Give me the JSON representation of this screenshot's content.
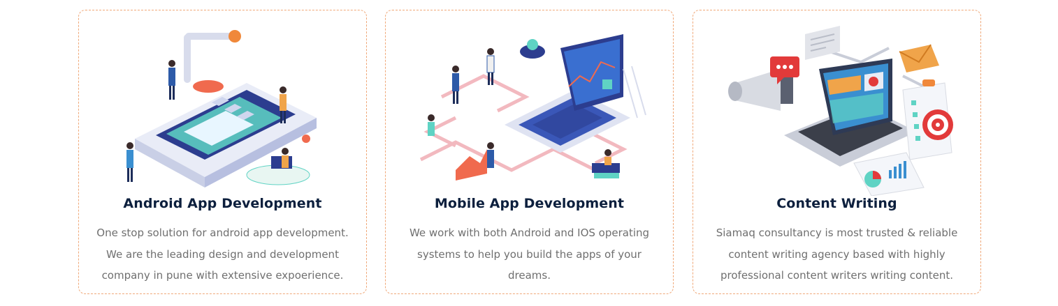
{
  "services": [
    {
      "title": "Android App Development",
      "description": "One stop solution for android app development. We are the leading design and development company in pune with extensive expoerience."
    },
    {
      "title": "Mobile App Development",
      "description": "We work with both Android and IOS operating systems to help you build the apps of your dreams."
    },
    {
      "title": "Content Writing",
      "description": "Siamaq consultancy is most trusted & reliable content writing agency based with highly professional content writers writing content."
    }
  ]
}
